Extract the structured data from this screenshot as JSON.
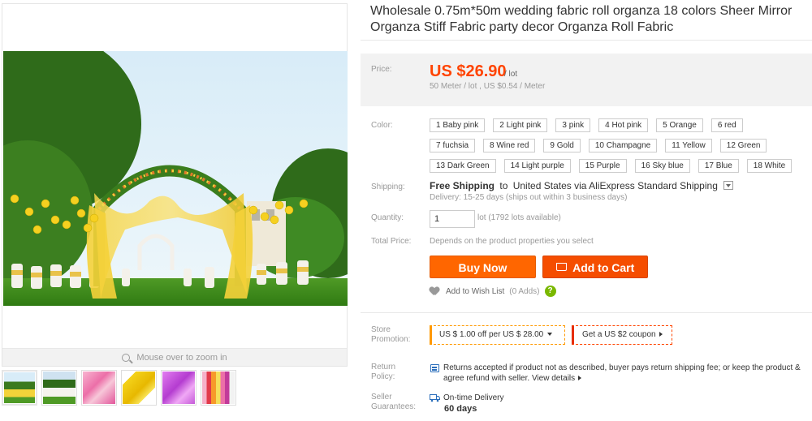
{
  "product": {
    "title": "Wholesale 0.75m*50m wedding fabric roll organza 18 colors Sheer Mirror Organza Stiff Fabric party decor Organza Roll Fabric"
  },
  "gallery": {
    "zoom_hint": "Mouse over to zoom in",
    "thumbnails": [
      "arch-yellow-icon",
      "arch-white-icon",
      "fabric-pink-icon",
      "fabric-yellow-icon",
      "fabric-purple-icon",
      "fabric-multi-icon"
    ]
  },
  "price": {
    "label": "Price:",
    "amount": "US $26.90",
    "unit": "/ lot",
    "sub": "50 Meter / lot , US $0.54 / Meter"
  },
  "color": {
    "label": "Color:",
    "options": [
      "1 Baby pink",
      "2 Light pink",
      "3 pink",
      "4 Hot pink",
      "5 Orange",
      "6 red",
      "7 fuchsia",
      "8 Wine red",
      "9 Gold",
      "10 Champagne",
      "11 Yellow",
      "12 Green",
      "13 Dark Green",
      "14 Light purple",
      "15 Purple",
      "16 Sky blue",
      "17 Blue",
      "18 White"
    ]
  },
  "shipping": {
    "label": "Shipping:",
    "free": "Free Shipping",
    "to": "to",
    "destination": "United States via AliExpress Standard Shipping",
    "delivery": "Delivery: 15-25 days (ships out within 3 business days)"
  },
  "quantity": {
    "label": "Quantity:",
    "value": "1",
    "note": "lot (1792 lots available)"
  },
  "total": {
    "label": "Total Price:",
    "value": "Depends on the product properties you select"
  },
  "actions": {
    "buy_now": "Buy Now",
    "add_to_cart": "Add to Cart",
    "wish": "Add to Wish List",
    "adds": "(0 Adds)",
    "help": "?"
  },
  "promotion": {
    "label": "Store Promotion:",
    "offer": "US $ 1.00 off per US $ 28.00",
    "coupon": "Get a US $2 coupon"
  },
  "return_policy": {
    "label": "Return Policy:",
    "text": "Returns accepted if product not as described, buyer pays return shipping fee; or keep the product & agree refund with seller.",
    "link": "View details"
  },
  "guarantee": {
    "label": "Seller Guarantees:",
    "item": "On-time Delivery",
    "days": "60 days"
  },
  "colors": {
    "price": "#ff4400",
    "buy_now": "#ff6600",
    "add_to_cart": "#f54d00",
    "help": "#7ab800"
  }
}
